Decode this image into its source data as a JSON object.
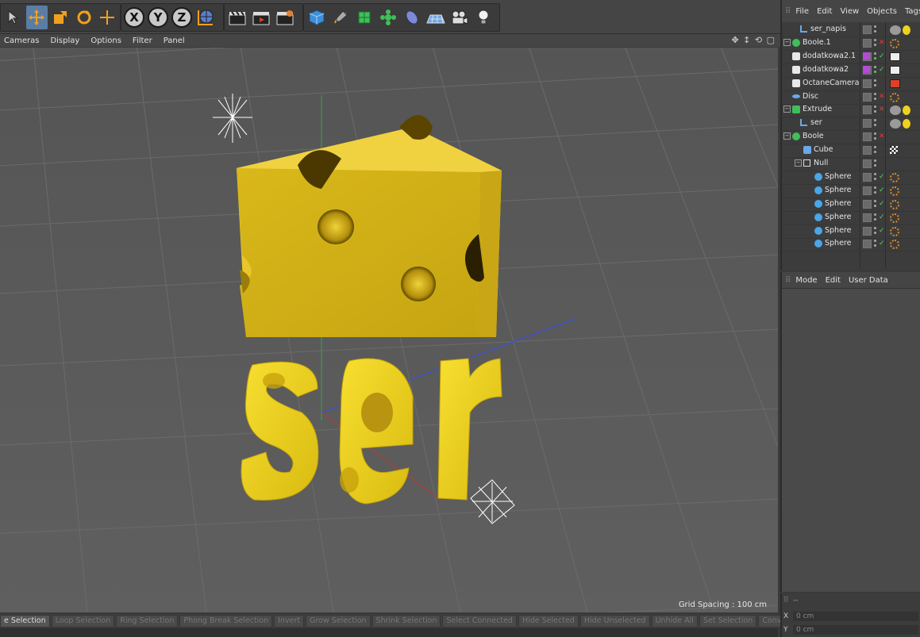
{
  "toolbar": {
    "axis_buttons": [
      "X",
      "Y",
      "Z"
    ]
  },
  "viewport_menu": [
    "Cameras",
    "Display",
    "Options",
    "Filter",
    "Panel"
  ],
  "viewport": {
    "grid_spacing": "Grid Spacing : 100 cm",
    "text_object": "ser"
  },
  "selection_bar": [
    "e Selection",
    "Loop Selection",
    "Ring Selection",
    "Phong Break Selection",
    "Invert",
    "Grow Selection",
    "Shrink Selection",
    "Select Connected",
    "Hide Selected",
    "Hide Unselected",
    "Unhide All",
    "Set Selection",
    "Convert Selection"
  ],
  "object_manager": {
    "menu": [
      "File",
      "Edit",
      "View",
      "Objects",
      "Tags"
    ],
    "objects": [
      {
        "name": "ser_napis",
        "icon": "null-axis-icon"
      },
      {
        "name": "Boole.1",
        "icon": "boole-icon"
      },
      {
        "name": "dodatkowa2.1",
        "icon": "plane-icon"
      },
      {
        "name": "dodatkowa2",
        "icon": "plane-icon"
      },
      {
        "name": "OctaneCamera",
        "icon": "camera-icon"
      },
      {
        "name": "Disc",
        "icon": "disc-icon"
      },
      {
        "name": "Extrude",
        "icon": "extrude-icon"
      },
      {
        "name": "ser",
        "icon": "null-axis-icon"
      },
      {
        "name": "Boole",
        "icon": "boole-icon"
      },
      {
        "name": "Cube",
        "icon": "cube-icon"
      },
      {
        "name": "Null",
        "icon": "null-icon"
      },
      {
        "name": "Sphere",
        "icon": "sphere-icon"
      },
      {
        "name": "Sphere",
        "icon": "sphere-icon"
      },
      {
        "name": "Sphere",
        "icon": "sphere-icon"
      },
      {
        "name": "Sphere",
        "icon": "sphere-icon"
      },
      {
        "name": "Sphere",
        "icon": "sphere-icon"
      },
      {
        "name": "Sphere",
        "icon": "sphere-icon"
      }
    ]
  },
  "attribute_manager": {
    "menu": [
      "Mode",
      "Edit",
      "User Data"
    ]
  },
  "coordinates": {
    "header": "--",
    "x_label": "X",
    "x_value": "0 cm",
    "y_label": "Y",
    "y_value": "0 cm"
  },
  "colors": {
    "cheese": "#d8b71a",
    "text_yellow": "#f0d21c",
    "active_tool": "#5a7da6"
  }
}
